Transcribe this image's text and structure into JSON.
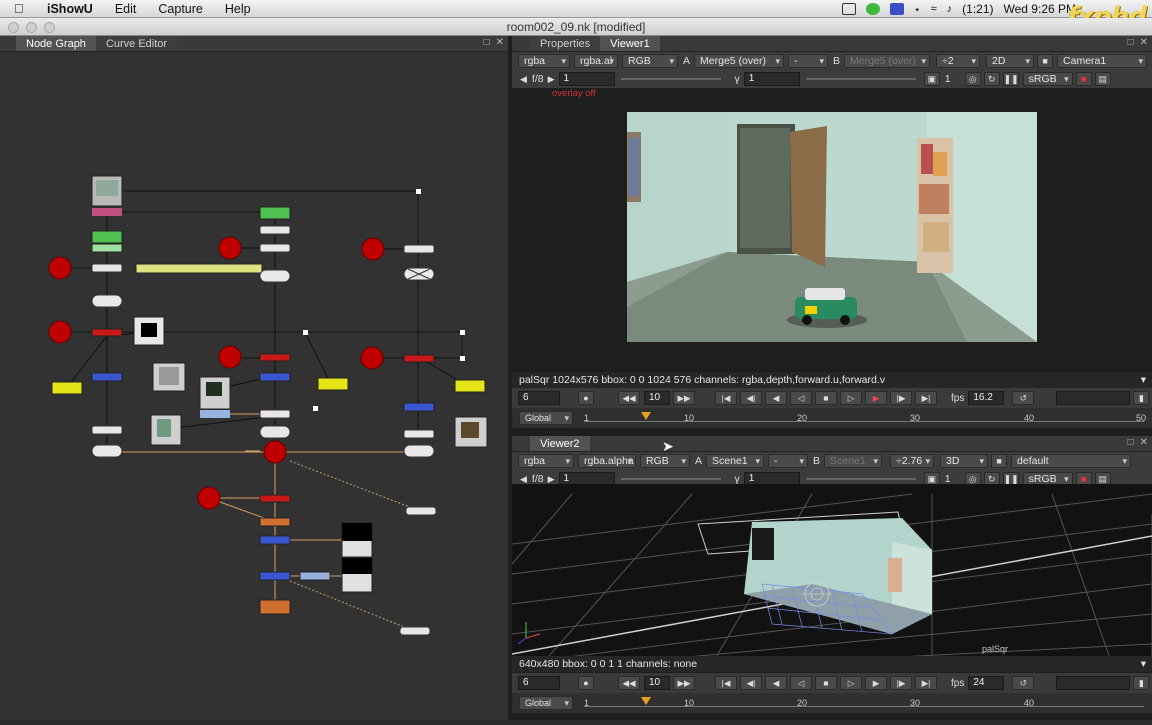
{
  "menubar": {
    "app": "iShowU",
    "items": [
      "Edit",
      "Capture",
      "Help"
    ],
    "battery": "(1:21)",
    "clock": "Wed 9:26 PM"
  },
  "brand": {
    "logo": "fxphd"
  },
  "window": {
    "title": "room002_09.nk [modified]"
  },
  "left_pane": {
    "tabs": [
      "Node Graph",
      "Curve Editor"
    ]
  },
  "viewer1": {
    "tabs": [
      "Properties",
      "Viewer1"
    ],
    "row1": {
      "channels": "rgba",
      "alpha": "rgba.al",
      "mode": "RGB",
      "a_label": "A",
      "a_input": "Merge5 (over)",
      "op": "-",
      "b_label": "B",
      "b_input": "Merge5 (over)",
      "zoom": "÷2",
      "view": "2D",
      "camera": "Camera1"
    },
    "row2": {
      "fstop": "f/8",
      "frame": "1",
      "gamma_label": "γ",
      "gamma": "1",
      "lut_frame": "1",
      "lut": "sRGB"
    },
    "overlay": "overlay off",
    "info": "palSqr 1024x576 bbox: 0 0 1024 576 channels: rgba,depth,forward.u,forward.v",
    "frame": "6",
    "increment": "10",
    "fps_label": "fps",
    "fps": "16.2",
    "range": "Global",
    "ticks": [
      "1",
      "10",
      "20",
      "30",
      "40",
      "50"
    ]
  },
  "viewer2": {
    "tabs": [
      "Viewer2"
    ],
    "row1": {
      "channels": "rgba",
      "alpha": "rgba.alpha",
      "mode": "RGB",
      "a_label": "A",
      "a_input": "Scene1",
      "op": "-",
      "b_label": "B",
      "b_input": "Scene1",
      "zoom": "÷2.76",
      "view": "3D",
      "camera": "default"
    },
    "row2": {
      "fstop": "f/8",
      "frame": "1",
      "gamma_label": "γ",
      "gamma": "1",
      "lut_frame": "1",
      "lut": "sRGB"
    },
    "scene_label": "palSqr",
    "info": "640x480 bbox: 0 0 1 1 channels: none",
    "frame": "6",
    "increment": "10",
    "fps_label": "fps",
    "fps": "24",
    "range": "Global",
    "ticks": [
      "1",
      "10",
      "20",
      "30",
      "40"
    ]
  },
  "colors": {
    "read_node": "#a0a0a0",
    "merge_node": "#c00000",
    "transform_node": "#2050d0",
    "grade_node": "#e4e417",
    "color_node": "#50c050",
    "scene_node": "#d07030",
    "pipe_orange": "#d8a060"
  }
}
